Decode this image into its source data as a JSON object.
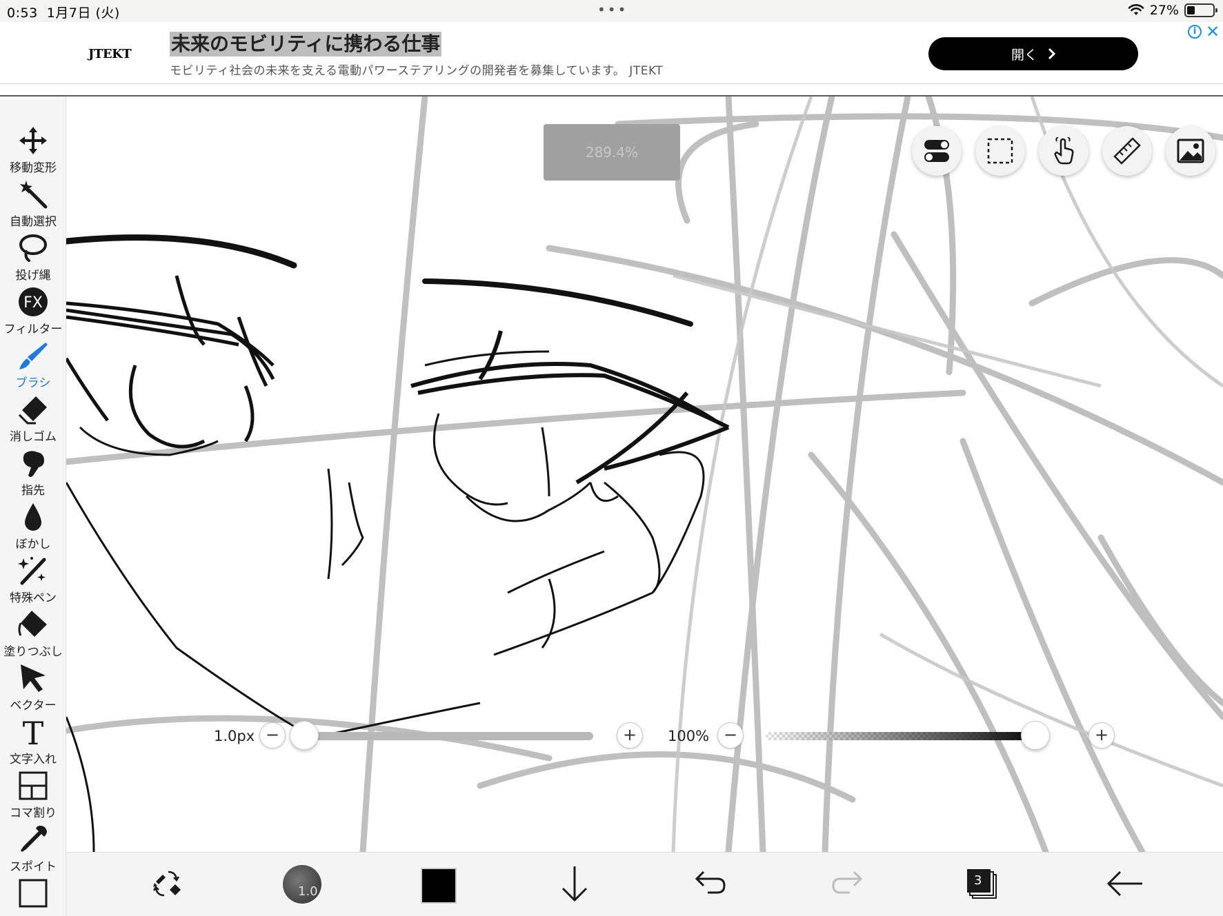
{
  "status_bar": {
    "time": "0:53",
    "date": "1月7日 (火)",
    "dots": "•••",
    "battery": "27%"
  },
  "ad": {
    "logo": "JTEKT",
    "title": "未来のモビリティに携わる仕事",
    "description": "モビリティ社会の未来を支える電動パワーステアリングの開発者を募集しています。 JTEKT",
    "open_label": "開く",
    "close_label": "✕",
    "info_label": "i"
  },
  "tools": [
    {
      "name": "move",
      "label": "移動変形"
    },
    {
      "name": "magic-wand",
      "label": "自動選択"
    },
    {
      "name": "lasso",
      "label": "投げ縄"
    },
    {
      "name": "filter",
      "label": "フィルター"
    },
    {
      "name": "brush",
      "label": "ブラシ",
      "active": true
    },
    {
      "name": "eraser",
      "label": "消しゴム"
    },
    {
      "name": "smudge",
      "label": "指先"
    },
    {
      "name": "blur",
      "label": "ぼかし"
    },
    {
      "name": "special-pen",
      "label": "特殊ペン"
    },
    {
      "name": "fill",
      "label": "塗りつぶし"
    },
    {
      "name": "vector",
      "label": "ベクター"
    },
    {
      "name": "text",
      "label": "文字入れ"
    },
    {
      "name": "frame",
      "label": "コマ割り"
    },
    {
      "name": "eyedropper",
      "label": "スポイト"
    }
  ],
  "filter_icon_text": "FX",
  "text_tool_glyph": "T",
  "canvas": {
    "zoom": "289.4%"
  },
  "brush_size": {
    "value": "1.0px",
    "minus": "−",
    "plus": "+",
    "fraction": 0.0
  },
  "brush_opacity": {
    "value": "100%",
    "minus": "−",
    "plus": "+",
    "fraction": 1.0
  },
  "bottom": {
    "brush_size_preview": "1.0",
    "color": "#000000",
    "layer_count": "3"
  },
  "colors": {
    "accent": "#1f7ae0",
    "ad_button": "#000000"
  }
}
